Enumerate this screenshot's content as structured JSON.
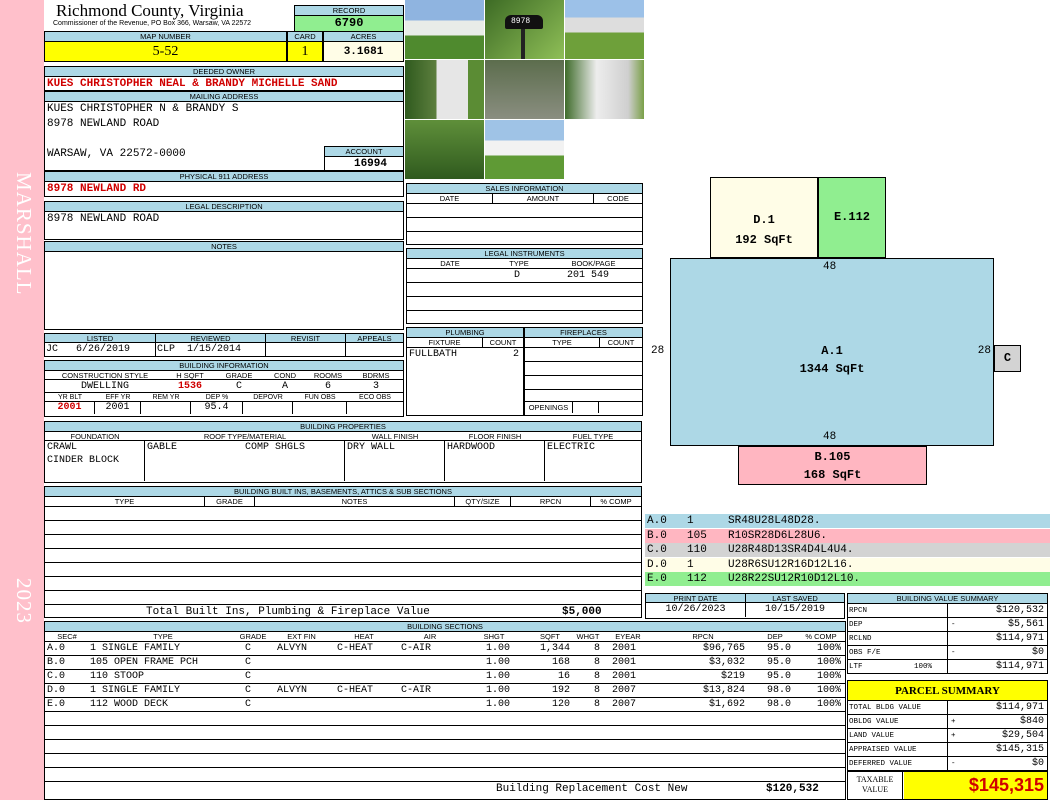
{
  "side": {
    "district": "MARSHALL",
    "year": "2023"
  },
  "header": {
    "county": "Richmond County, Virginia",
    "commissioner": "Commissioner of the Revenue, PO Box 366, Warsaw, VA 22572",
    "record_label": "RECORD",
    "record": "6790",
    "map_label": "MAP NUMBER",
    "map": "5-52",
    "card_label": "CARD",
    "card": "1",
    "acres_label": "ACRES",
    "acres": "3.1681"
  },
  "owner": {
    "label": "DEEDED OWNER",
    "value": "KUES CHRISTOPHER NEAL & BRANDY MICHELLE SAND"
  },
  "mailing": {
    "label": "MAILING ADDRESS",
    "line1": "KUES CHRISTOPHER N & BRANDY S",
    "line2": "8978 NEWLAND ROAD",
    "line3": "WARSAW, VA 22572-0000"
  },
  "account": {
    "label": "ACCOUNT",
    "value": "16994"
  },
  "physical": {
    "label": "PHYSICAL 911 ADDRESS",
    "value": "8978 NEWLAND RD"
  },
  "legal": {
    "label": "LEGAL DESCRIPTION",
    "value": "8978 NEWLAND ROAD"
  },
  "notes": {
    "label": "NOTES"
  },
  "photos": {
    "mailbox": "8978"
  },
  "sales": {
    "label": "SALES INFORMATION",
    "cols": [
      "DATE",
      "AMOUNT",
      "CODE"
    ]
  },
  "instruments": {
    "label": "LEGAL INSTRUMENTS",
    "cols": [
      "DATE",
      "TYPE",
      "BOOK/PAGE"
    ],
    "row": {
      "type": "D",
      "book": "201 549"
    }
  },
  "plumbing": {
    "label": "PLUMBING",
    "cols": [
      "FIXTURE",
      "COUNT"
    ],
    "fixture": "FULLBATH",
    "count": "2"
  },
  "fireplaces": {
    "label": "FIREPLACES",
    "cols": [
      "TYPE",
      "COUNT"
    ],
    "openings": "OPENINGS"
  },
  "listed": {
    "cols": [
      "LISTED",
      "REVIEWED",
      "REVISIT",
      "APPEALS"
    ],
    "listed_by": "JC",
    "listed_date": "6/26/2019",
    "reviewed_by": "CLP",
    "reviewed_date": "1/15/2014"
  },
  "building_info": {
    "label": "BUILDING INFORMATION",
    "cols": [
      "CONSTRUCTION STYLE",
      "H SQFT",
      "GRADE",
      "COND",
      "ROOMS",
      "BDRMS"
    ],
    "style": "DWELLING",
    "hsqft": "1536",
    "grade": "C",
    "cond": "A",
    "rooms": "6",
    "bdrms": "3",
    "cols2": [
      "YR BLT",
      "EFF YR",
      "REM YR",
      "DEP %",
      "DEPOVR",
      "FUN OBS",
      "ECO OBS"
    ],
    "yr_blt": "2001",
    "eff_yr": "2001",
    "dep": "95.4"
  },
  "properties": {
    "label": "BUILDING PROPERTIES",
    "cols": [
      "FOUNDATION",
      "ROOF TYPE/MATERIAL",
      "WALL FINISH",
      "FLOOR FINISH",
      "FUEL TYPE"
    ],
    "foundation1": "CRAWL",
    "foundation2": "CINDER BLOCK",
    "roof_type": "GABLE",
    "roof_mat": "COMP SHGLS",
    "wall": "DRY WALL",
    "floor": "HARDWOOD",
    "fuel": "ELECTRIC"
  },
  "builtins": {
    "label": "BUILDING BUILT INS, BASEMENTS, ATTICS & SUB SECTIONS",
    "cols": [
      "TYPE",
      "GRADE",
      "NOTES",
      "QTY/SIZE",
      "RPCN",
      "% COMP"
    ],
    "total_label": "Total Built Ins, Plumbing & Fireplace Value",
    "total": "$5,000"
  },
  "sketch": {
    "d": {
      "name": "D.1",
      "area": "192 SqFt"
    },
    "e": {
      "name": "E.112"
    },
    "a": {
      "name": "A.1",
      "area": "1344 SqFt",
      "top": "48",
      "bottom": "48",
      "left": "28",
      "right": "28"
    },
    "b": {
      "name": "B.105",
      "area": "168 SqFt"
    },
    "c": {
      "name": "C"
    }
  },
  "legend": [
    {
      "code": "A.0",
      "num": "1",
      "path": "SR48U28L48D28.",
      "color": "#add8e6"
    },
    {
      "code": "B.0",
      "num": "105",
      "path": "R10SR28D6L28U6.",
      "color": "#ffb6c1"
    },
    {
      "code": "C.0",
      "num": "110",
      "path": "U28R48D13SR4D4L4U4.",
      "color": "#d3d3d3"
    },
    {
      "code": "D.0",
      "num": "1",
      "path": "U28R6SU12R16D12L16.",
      "color": "#fffde7"
    },
    {
      "code": "E.0",
      "num": "112",
      "path": "U28R22SU12R10D12L10.",
      "color": "#90ee90"
    }
  ],
  "dates": {
    "print_label": "PRINT DATE",
    "print": "10/26/2023",
    "saved_label": "LAST SAVED",
    "saved": "10/15/2019"
  },
  "sections": {
    "label": "BUILDING SECTIONS",
    "cols": [
      "SEC#",
      "TYPE",
      "GRADE",
      "EXT FIN",
      "HEAT",
      "AIR",
      "SHGT",
      "SQFT",
      "WHGT",
      "EYEAR",
      "RPCN",
      "DEP",
      "% COMP"
    ],
    "rows": [
      {
        "sec": "A.0",
        "type": "1 SINGLE FAMILY",
        "grade": "C",
        "ext": "ALVYN",
        "heat": "C-HEAT",
        "air": "C-AIR",
        "shgt": "1.00",
        "sqft": "1,344",
        "whgt": "8",
        "eyear": "2001",
        "rpcn": "$96,765",
        "dep": "95.0",
        "comp": "100%"
      },
      {
        "sec": "B.0",
        "type": "105 OPEN FRAME PCH",
        "grade": "C",
        "ext": "",
        "heat": "",
        "air": "",
        "shgt": "1.00",
        "sqft": "168",
        "whgt": "8",
        "eyear": "2001",
        "rpcn": "$3,032",
        "dep": "95.0",
        "comp": "100%"
      },
      {
        "sec": "C.0",
        "type": "110 STOOP",
        "grade": "C",
        "ext": "",
        "heat": "",
        "air": "",
        "shgt": "1.00",
        "sqft": "16",
        "whgt": "8",
        "eyear": "2001",
        "rpcn": "$219",
        "dep": "95.0",
        "comp": "100%"
      },
      {
        "sec": "D.0",
        "type": "1 SINGLE FAMILY",
        "grade": "C",
        "ext": "ALVYN",
        "heat": "C-HEAT",
        "air": "C-AIR",
        "shgt": "1.00",
        "sqft": "192",
        "whgt": "8",
        "eyear": "2007",
        "rpcn": "$13,824",
        "dep": "98.0",
        "comp": "100%"
      },
      {
        "sec": "E.0",
        "type": "112 WOOD DECK",
        "grade": "C",
        "ext": "",
        "heat": "",
        "air": "",
        "shgt": "1.00",
        "sqft": "120",
        "whgt": "8",
        "eyear": "2007",
        "rpcn": "$1,692",
        "dep": "98.0",
        "comp": "100%"
      }
    ],
    "total_label": "Building Replacement Cost New",
    "total": "$120,532"
  },
  "bvs": {
    "label": "BUILDING VALUE SUMMARY",
    "rows": [
      {
        "k": "RPCN",
        "s": "",
        "p": "",
        "v": "$120,532"
      },
      {
        "k": "DEP",
        "s": "-",
        "p": "",
        "v": "$5,561"
      },
      {
        "k": "RCLND",
        "s": "",
        "p": "",
        "v": "$114,971"
      },
      {
        "k": "OBS F/E",
        "s": "-",
        "p": "",
        "v": "$0"
      },
      {
        "k": "LTF",
        "s": "",
        "p": "100%",
        "v": "$114,971"
      }
    ]
  },
  "parcel": {
    "label": "PARCEL SUMMARY",
    "rows": [
      {
        "k": "TOTAL BLDG VALUE",
        "s": "",
        "v": "$114,971"
      },
      {
        "k": "OBLDG VALUE",
        "s": "+",
        "v": "$840"
      },
      {
        "k": "LAND VALUE",
        "s": "+",
        "v": "$29,504"
      },
      {
        "k": "APPRAISED VALUE",
        "s": "",
        "v": "$145,315"
      },
      {
        "k": "DEFERRED VALUE",
        "s": "-",
        "v": "$0"
      }
    ],
    "taxable_label1": "TAXABLE",
    "taxable_label2": "VALUE",
    "taxable": "$145,315"
  }
}
